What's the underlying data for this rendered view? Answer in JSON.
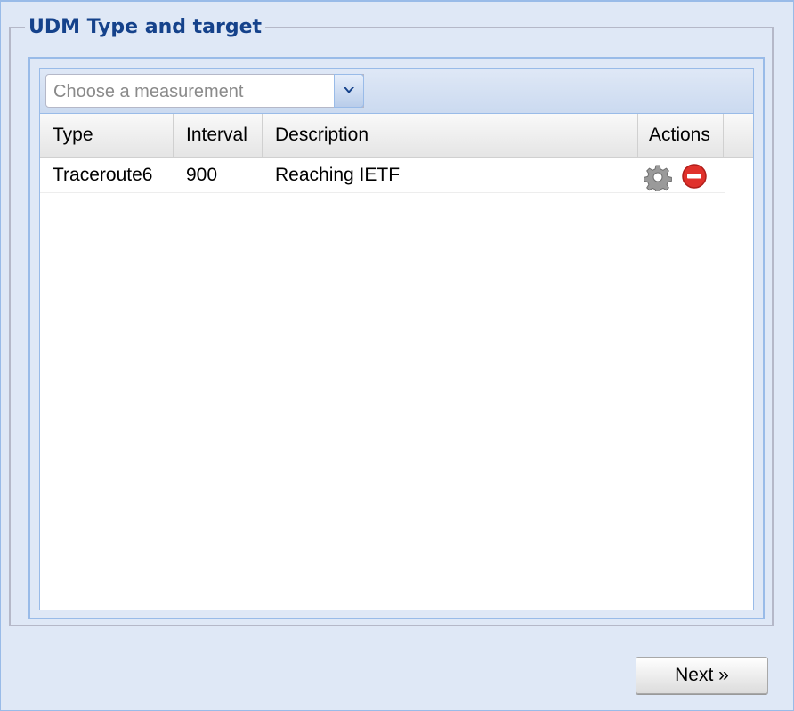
{
  "fieldset": {
    "title": "UDM Type and target"
  },
  "measurement_combo": {
    "placeholder": "Choose a measurement"
  },
  "grid": {
    "columns": [
      "Type",
      "Interval",
      "Description",
      "Actions"
    ],
    "rows": [
      {
        "type": "Traceroute6",
        "interval": "900",
        "description": "Reaching IETF",
        "actions": [
          "gear-icon",
          "remove-icon"
        ]
      }
    ]
  },
  "footer": {
    "next_label": "Next »"
  },
  "colors": {
    "accent": "#15428b",
    "border": "#99bbe8",
    "panel_bg": "#dfe8f6",
    "remove": "#e0312b"
  }
}
